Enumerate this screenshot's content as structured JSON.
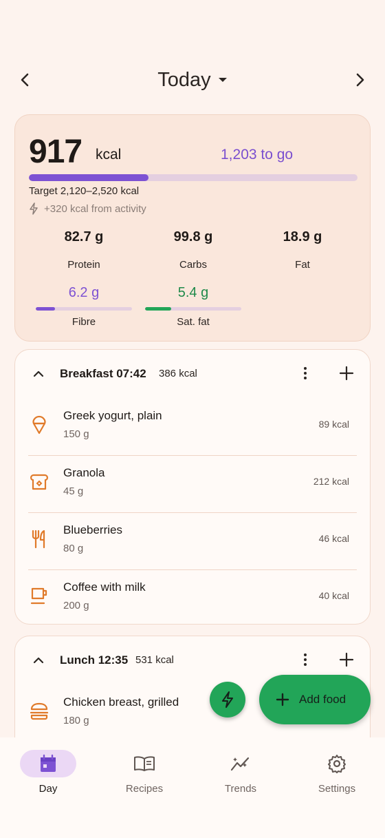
{
  "header": {
    "title": "Today"
  },
  "summary": {
    "kcal_value": "917",
    "kcal_unit": "kcal",
    "to_go": "1,203 to go",
    "progress_fraction": 0.363,
    "target": "Target 2,120–2,520 kcal",
    "activity": "+320 kcal from activity",
    "macros": [
      {
        "value": "82.7 g",
        "label": "Protein"
      },
      {
        "value": "99.8 g",
        "label": "Carbs"
      },
      {
        "value": "18.9 g",
        "label": "Fat"
      }
    ],
    "minor": [
      {
        "value": "6.2 g",
        "label": "Fibre",
        "fraction": 0.2,
        "color": "#7d52d3"
      },
      {
        "value": "5.4 g",
        "label": "Sat. fat",
        "fraction": 0.27,
        "color": "#22a558"
      }
    ]
  },
  "meals": [
    {
      "name": "Breakfast 07:42",
      "kcal": "386 kcal",
      "foods": [
        {
          "name": "Greek yogurt, plain",
          "qty": "150 g",
          "kcal": "89 kcal",
          "icon": "ice-cream-icon"
        },
        {
          "name": "Granola",
          "qty": "45 g",
          "kcal": "212 kcal",
          "icon": "bread-icon"
        },
        {
          "name": "Blueberries",
          "qty": "80 g",
          "kcal": "46 kcal",
          "icon": "cutlery-icon"
        },
        {
          "name": "Coffee with milk",
          "qty": "200 g",
          "kcal": "40 kcal",
          "icon": "coffee-icon"
        }
      ]
    },
    {
      "name": "Lunch 12:35",
      "kcal": "531 kcal",
      "foods": [
        {
          "name": "Chicken breast, grilled",
          "qty": "180 g",
          "kcal": "",
          "icon": "burger-icon"
        }
      ]
    }
  ],
  "fab": {
    "add_label": "Add food"
  },
  "nav": [
    {
      "label": "Day",
      "icon": "calendar-icon",
      "active": true
    },
    {
      "label": "Recipes",
      "icon": "book-icon",
      "active": false
    },
    {
      "label": "Trends",
      "icon": "trends-icon",
      "active": false
    },
    {
      "label": "Settings",
      "icon": "gear-icon",
      "active": false
    }
  ],
  "colors": {
    "accent": "#7d52d3",
    "green": "#22a558",
    "icon_orange": "#e07a2a",
    "background": "#fdf3ee"
  }
}
